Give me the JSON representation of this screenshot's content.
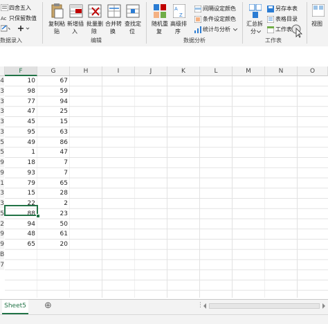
{
  "ribbon": {
    "round_label": "四舍五入",
    "keep_value_label": "只保留数值",
    "data_entry_group": "数据录入",
    "copy_paste_label": "复制粘",
    "copy_paste_sub": "贴",
    "insert_label": "新增插",
    "insert_sub": "入",
    "batch_delete_label": "批量删",
    "batch_delete_sub": "除",
    "merge_label": "合并转",
    "merge_sub": "换",
    "find_label": "查找定",
    "find_sub": "位",
    "edit_group": "编辑",
    "random_label": "随机重",
    "random_sub": "复",
    "adv_sort_label": "高级排",
    "adv_sort_sub": "序",
    "interval_color_label": "间隔设定颜色",
    "cond_color_label": "条件设定颜色",
    "stats_label": "统计与分析",
    "data_analysis_group": "数据分析",
    "summary_label": "汇总拆",
    "summary_sub": "分",
    "save_sheet_label": "另存本表",
    "sheet_dir_label": "表格目录",
    "worksheet_label": "工作表",
    "worksheet_group": "工作表",
    "view_label": "视图"
  },
  "columns": [
    "F",
    "G",
    "H",
    "I",
    "J",
    "K",
    "L",
    "M",
    "N",
    "O"
  ],
  "row_stubs": [
    "4",
    "3",
    "3",
    "3",
    "3",
    "3",
    "5",
    "5",
    "9",
    "9",
    "1",
    "3",
    "3",
    "5",
    "2",
    "9",
    "9",
    "B",
    "7"
  ],
  "rows": [
    {
      "f": "10",
      "g": "67"
    },
    {
      "f": "98",
      "g": "59"
    },
    {
      "f": "77",
      "g": "94"
    },
    {
      "f": "47",
      "g": "25"
    },
    {
      "f": "45",
      "g": "15"
    },
    {
      "f": "95",
      "g": "63"
    },
    {
      "f": "49",
      "g": "86"
    },
    {
      "f": "1",
      "g": "47"
    },
    {
      "f": "18",
      "g": "7"
    },
    {
      "f": "93",
      "g": "7"
    },
    {
      "f": "79",
      "g": "65"
    },
    {
      "f": "15",
      "g": "28"
    },
    {
      "f": "22",
      "g": "2"
    },
    {
      "f": "88",
      "g": "23"
    },
    {
      "f": "94",
      "g": "50"
    },
    {
      "f": "48",
      "g": "61"
    },
    {
      "f": "65",
      "g": "20"
    }
  ],
  "sheet_tab": "Sheet5",
  "add_sheet": "⊕",
  "colors": {
    "accent": "#217346",
    "ribbon_bg": "#f3f3f3",
    "grid": "#e2e2e2"
  }
}
